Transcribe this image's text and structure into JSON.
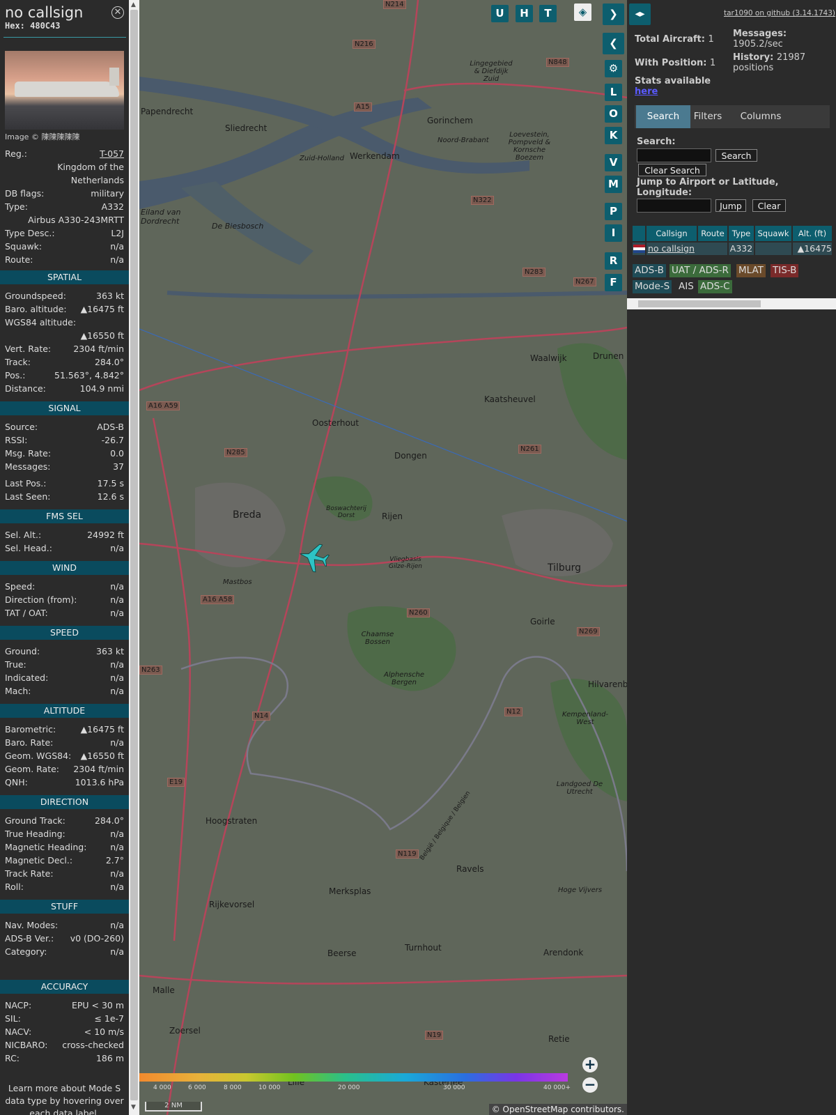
{
  "aircraft": {
    "callsign": "no callsign",
    "hex": "Hex: 480C43",
    "image_credit": "Image © 陳陳陳陳陳"
  },
  "details": [
    {
      "k": "Reg.:",
      "v": "T-057"
    },
    {
      "k": "",
      "v": "Kingdom of the"
    },
    {
      "k": "",
      "v": "Netherlands"
    },
    {
      "k": "DB flags:",
      "v": "military"
    },
    {
      "k": "Type:",
      "v": "A332"
    },
    {
      "k": "",
      "v": "Airbus A330-243MRTT"
    },
    {
      "k": "Type Desc.:",
      "v": "L2J"
    },
    {
      "k": "Squawk:",
      "v": "n/a"
    },
    {
      "k": "Route:",
      "v": "n/a"
    }
  ],
  "sections": {
    "spatial": "SPATIAL",
    "signal": "SIGNAL",
    "fms": "FMS SEL",
    "wind": "WIND",
    "speed": "SPEED",
    "altitude": "ALTITUDE",
    "direction": "DIRECTION",
    "stuff": "STUFF",
    "accuracy": "ACCURACY"
  },
  "spatial": [
    {
      "k": "Groundspeed:",
      "v": "363 kt"
    },
    {
      "k": "Baro. altitude:",
      "v": "▲16475 ft"
    },
    {
      "k": "WGS84 altitude:",
      "v": ""
    },
    {
      "k": "",
      "v": "▲16550 ft"
    },
    {
      "k": "Vert. Rate:",
      "v": "2304 ft/min"
    },
    {
      "k": "Track:",
      "v": "284.0°"
    },
    {
      "k": "Pos.:",
      "v": "51.563°, 4.842°"
    },
    {
      "k": "Distance:",
      "v": "104.9 nmi"
    }
  ],
  "signal": [
    {
      "k": "Source:",
      "v": "ADS-B"
    },
    {
      "k": "RSSI:",
      "v": "-26.7"
    },
    {
      "k": "Msg. Rate:",
      "v": "0.0"
    },
    {
      "k": "Messages:",
      "v": "37"
    },
    {
      "k": "Last Pos.:",
      "v": "17.5 s"
    },
    {
      "k": "Last Seen:",
      "v": "12.6 s"
    }
  ],
  "fms": [
    {
      "k": "Sel. Alt.:",
      "v": "24992 ft"
    },
    {
      "k": "Sel. Head.:",
      "v": "n/a"
    }
  ],
  "wind": [
    {
      "k": "Speed:",
      "v": "n/a"
    },
    {
      "k": "Direction (from):",
      "v": "n/a"
    },
    {
      "k": "TAT / OAT:",
      "v": "n/a"
    }
  ],
  "speed": [
    {
      "k": "Ground:",
      "v": "363 kt"
    },
    {
      "k": "True:",
      "v": "n/a"
    },
    {
      "k": "Indicated:",
      "v": "n/a"
    },
    {
      "k": "Mach:",
      "v": "n/a"
    }
  ],
  "altitude": [
    {
      "k": "Barometric:",
      "v": "▲16475 ft"
    },
    {
      "k": "Baro. Rate:",
      "v": "n/a"
    },
    {
      "k": "Geom. WGS84:",
      "v": "▲16550 ft"
    },
    {
      "k": "Geom. Rate:",
      "v": "2304 ft/min"
    },
    {
      "k": "QNH:",
      "v": "1013.6 hPa"
    }
  ],
  "direction": [
    {
      "k": "Ground Track:",
      "v": "284.0°"
    },
    {
      "k": "True Heading:",
      "v": "n/a"
    },
    {
      "k": "Magnetic Heading:",
      "v": "n/a"
    },
    {
      "k": "Magnetic Decl.:",
      "v": "2.7°"
    },
    {
      "k": "Track Rate:",
      "v": "n/a"
    },
    {
      "k": "Roll:",
      "v": "n/a"
    }
  ],
  "stuff": [
    {
      "k": "Nav. Modes:",
      "v": "n/a"
    },
    {
      "k": "ADS-B Ver.:",
      "v": "v0 (DO-260)"
    },
    {
      "k": "Category:",
      "v": "n/a"
    }
  ],
  "accuracy": [
    {
      "k": "NACP:",
      "v": "EPU < 30 m"
    },
    {
      "k": "SIL:",
      "v": "≤ 1e-7"
    },
    {
      "k": "NACV:",
      "v": "< 10 m/s"
    },
    {
      "k": "NICBARO:",
      "v": "cross-checked"
    },
    {
      "k": "RC:",
      "v": "186 m"
    }
  ],
  "learn_more": "Learn more about Mode S data type by hovering over each data label.",
  "map": {
    "labels": [
      "Breda",
      "Tilburg",
      "Oosterhout",
      "Dongen",
      "Rijen",
      "Gorinchem",
      "Sliedrecht",
      "Werkendam",
      "Papendrecht",
      "Waalwijk",
      "Kaatsheuvel",
      "Drunen",
      "Goirle",
      "Hilvarenbeek",
      "Hoogstraten",
      "Merksplas",
      "Rijkevorsel",
      "Beerse",
      "Turnhout",
      "Ravels",
      "Arendonk",
      "Malle",
      "Zoersel",
      "Retie",
      "Mastbos",
      "De Biesbosch",
      "Eiland van Dordrecht",
      "Chaamse Bossen",
      "Alphensche Bergen",
      "Kempenland-West",
      "Landgoed De Utrecht",
      "Hoge Vijvers",
      "Lingegebied & Diefdijk Zuid",
      "Loevestein, Pompveld & Kornsche Boezem",
      "Vliegbasis Gilze-Rijen",
      "Boswachterij Dorst",
      "Zuid-Holland",
      "Noord-Brabant",
      "België / Belgique / Belgien",
      "Lille",
      "Kasterlee"
    ],
    "roads": [
      "N214",
      "N216",
      "N848",
      "A15",
      "N322",
      "N283",
      "N267",
      "A16 A59",
      "N285",
      "N261",
      "A16 A58",
      "N260",
      "N269",
      "N263",
      "N14",
      "N12",
      "E19",
      "N119",
      "N19"
    ],
    "buttons": [
      "U",
      "H",
      "T",
      "L",
      "O",
      "K",
      "V",
      "M",
      "P",
      "I",
      "R",
      "F"
    ],
    "scale": "2 NM",
    "attribution": "© OpenStreetMap contributors.",
    "altitude_scale": [
      "4 000",
      "6 000",
      "8 000",
      "10 000",
      "20 000",
      "30 000",
      "40 000+"
    ]
  },
  "right": {
    "github": "tar1090 on github (3.14.1743)",
    "total_label": "Total Aircraft:",
    "total_value": "1",
    "with_pos_label": "With Position:",
    "with_pos_value": "1",
    "messages_label": "Messages:",
    "messages_value": "1905.2/sec",
    "history_label": "History:",
    "history_value": "21987 positions",
    "stats_label": "Stats available",
    "stats_link": "here",
    "tabs": [
      "Search",
      "Filters",
      "Columns"
    ],
    "search_label": "Search:",
    "search_btn": "Search",
    "clear_search_btn": "Clear Search",
    "jump_label": "Jump to Airport or Latitude, Longitude:",
    "jump_btn": "Jump",
    "clear_btn": "Clear",
    "table_headers": [
      "Callsign",
      "Route",
      "Type",
      "Squawk",
      "Alt. (ft)"
    ],
    "table_row": {
      "callsign": "no callsign",
      "route": "",
      "type": "A332",
      "squawk": "",
      "alt": "▲16475"
    },
    "badges": [
      "ADS-B",
      "UAT / ADS-R",
      "MLAT",
      "TIS-B",
      "Mode-S",
      "AIS",
      "ADS-C"
    ]
  },
  "colors": {
    "section_bg": "#0a4b5e",
    "button_bg": "#0d5e6e",
    "aircraft": "#2ec4c4",
    "badge_adsb": "#1f4c57",
    "badge_uat": "#3b6b3b",
    "badge_mlat": "#6a4a2a",
    "badge_tisb": "#7a2a2a"
  }
}
